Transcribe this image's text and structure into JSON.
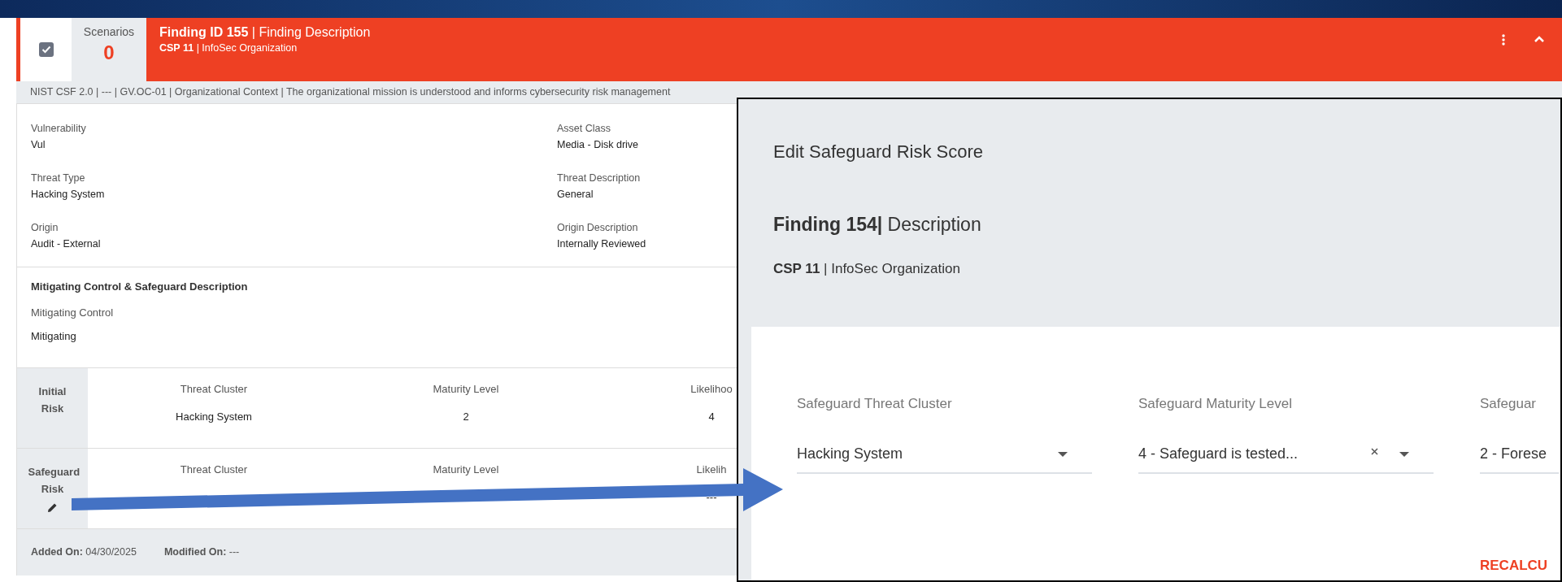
{
  "finding_header": {
    "checked": true,
    "scenarios_label": "Scenarios",
    "scenarios_count": "0",
    "title": "**Finding ID 155** | Finding Description",
    "subtitle": "**CSP 11** | InfoSec Organization"
  },
  "framework_line": "NIST CSF 2.0 | --- | GV.OC-01 | Organizational Context | The organizational mission is understood and informs cybersecurity risk management",
  "details": [
    {
      "label": "Vulnerability",
      "value": "Vul"
    },
    {
      "label": "Asset Class",
      "value": "Media - Disk drive"
    },
    {
      "label": "Threat Type",
      "value": "Hacking System"
    },
    {
      "label": "Threat Description",
      "value": "General"
    },
    {
      "label": "Origin",
      "value": "Audit - External"
    },
    {
      "label": "Origin Description",
      "value": "Internally Reviewed"
    }
  ],
  "mitigating": {
    "title": "Mitigating Control & Safeguard Description",
    "label": "Mitigating Control",
    "value": "Mitigating"
  },
  "risk_rows": [
    {
      "label": "Initial Risk",
      "editable": false,
      "cells": [
        {
          "label": "Threat Cluster",
          "value": "Hacking System"
        },
        {
          "label": "Maturity Level",
          "value": "2"
        },
        {
          "label": "Likelihoo",
          "value": "4"
        }
      ]
    },
    {
      "label": "Safeguard Risk",
      "editable": true,
      "cells": [
        {
          "label": "Threat Cluster"
        },
        {
          "label": "Maturity Level"
        },
        {
          "label": "Likelih",
          "value": "---"
        }
      ]
    }
  ],
  "footer": [
    {
      "label": "Added On:",
      "value": "04/30/2025"
    },
    {
      "label": "Modified On:",
      "value": "---"
    }
  ],
  "modal": {
    "title": "Edit Safeguard Risk Score",
    "finding": "**Finding 154|** Description",
    "subtitle": "**CSP 11** | InfoSec Organization",
    "fields": [
      {
        "label": "Safeguard Threat Cluster",
        "value": "Hacking System",
        "clearable": false
      },
      {
        "label": "Safeguard Maturity Level",
        "value": "4 - Safeguard is tested...",
        "clearable": true
      },
      {
        "label": "Safeguar",
        "value": "2 - Forese"
      }
    ],
    "action": "RECALCU"
  }
}
